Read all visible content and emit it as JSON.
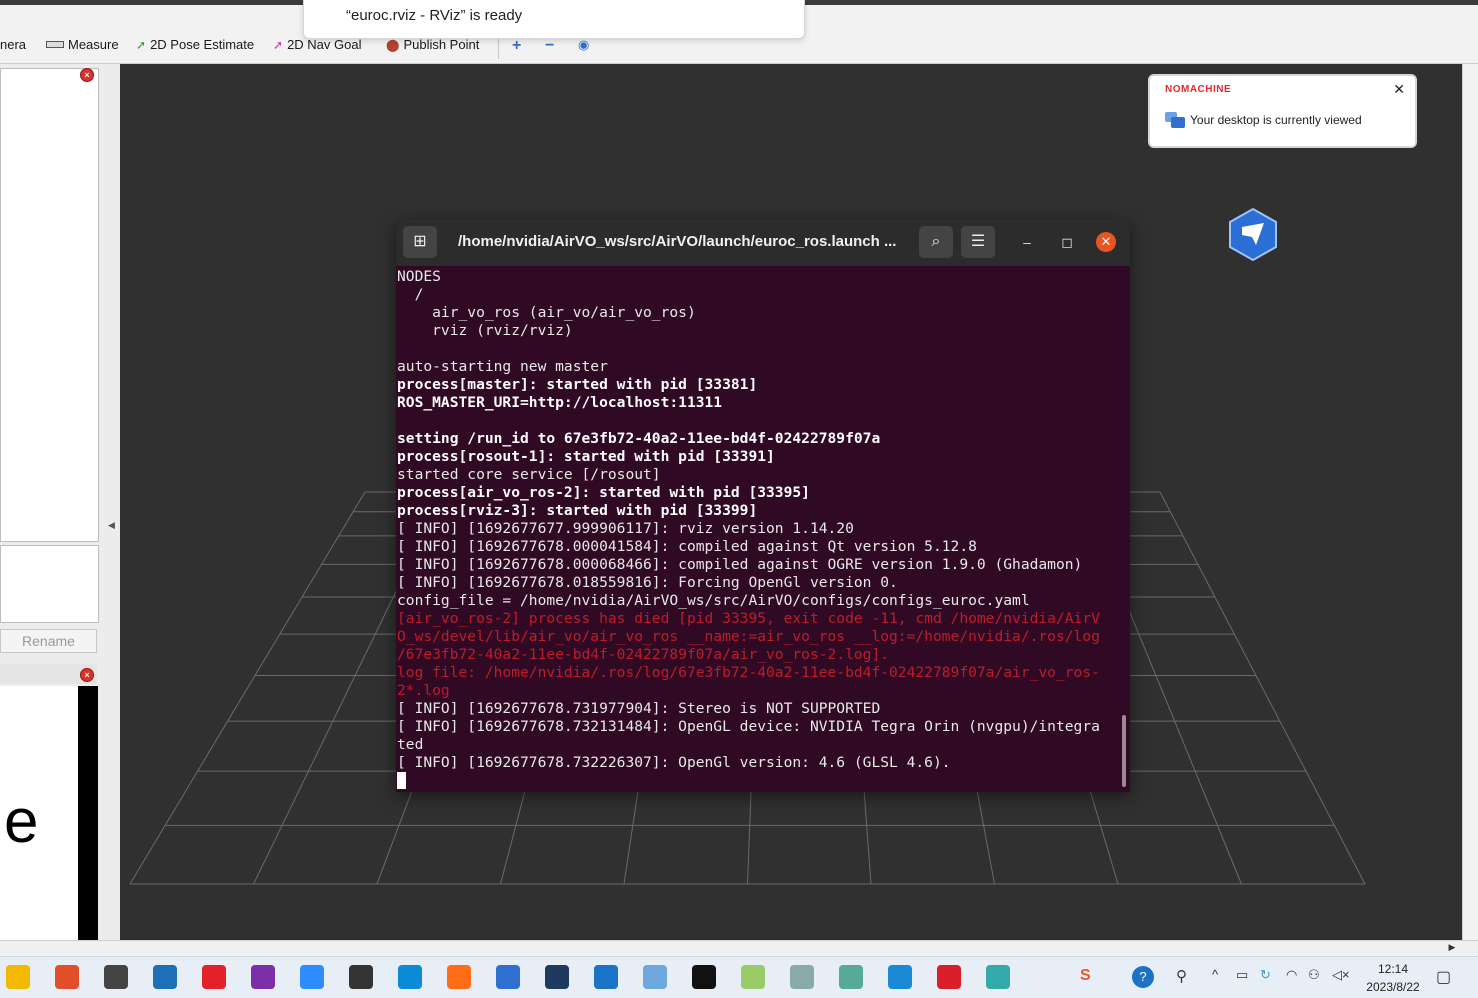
{
  "notification": {
    "text": "“euroc.rviz - RViz” is ready"
  },
  "toolbar": {
    "camera_partial": "nera",
    "measure": "Measure",
    "pose_estimate": "2D Pose Estimate",
    "nav_goal": "2D Nav Goal",
    "publish_point": "Publish Point"
  },
  "left_panel": {
    "rename_label": "Rename",
    "big_letter": "e"
  },
  "nomachine": {
    "brand": "NOMACHINE",
    "message": "Your desktop is currently viewed"
  },
  "terminal": {
    "title": "/home/nvidia/AirVO_ws/src/AirVO/launch/euroc_ros.launch ...",
    "lines": [
      "NODES",
      "  /",
      "    air_vo_ros (air_vo/air_vo_ros)",
      "    rviz (rviz/rviz)",
      "",
      "auto-starting new master",
      "process[master]: started with pid [33381]",
      "ROS_MASTER_URI=http://localhost:11311",
      "",
      "setting /run_id to 67e3fb72-40a2-11ee-bd4f-02422789f07a",
      "process[rosout-1]: started with pid [33391]",
      "started core service [/rosout]",
      "process[air_vo_ros-2]: started with pid [33395]",
      "process[rviz-3]: started with pid [33399]",
      "[ INFO] [1692677677.999906117]: rviz version 1.14.20",
      "[ INFO] [1692677678.000041584]: compiled against Qt version 5.12.8",
      "[ INFO] [1692677678.000068466]: compiled against OGRE version 1.9.0 (Ghadamon)",
      "[ INFO] [1692677678.018559816]: Forcing OpenGl version 0.",
      "config_file = /home/nvidia/AirVO_ws/src/AirVO/configs/configs_euroc.yaml",
      "[air_vo_ros-2] process has died [pid 33395, exit code -11, cmd /home/nvidia/AirV",
      "O_ws/devel/lib/air_vo/air_vo_ros __name:=air_vo_ros __log:=/home/nvidia/.ros/log",
      "/67e3fb72-40a2-11ee-bd4f-02422789f07a/air_vo_ros-2.log].",
      "log file: /home/nvidia/.ros/log/67e3fb72-40a2-11ee-bd4f-02422789f07a/air_vo_ros-",
      "2*.log",
      "[ INFO] [1692677678.731977904]: Stereo is NOT SUPPORTED",
      "[ INFO] [1692677678.732131484]: OpenGL device: NVIDIA Tegra Orin (nvgpu)/integra",
      "ted",
      "[ INFO] [1692677678.732226307]: OpenGl version: 4.6 (GLSL 4.6)."
    ],
    "bold_lines": [
      0,
      0,
      0,
      0,
      0,
      0,
      1,
      1,
      0,
      1,
      1,
      0,
      1,
      1,
      0,
      0,
      0,
      0,
      0,
      0,
      0,
      0,
      0,
      0,
      0,
      0,
      0,
      0
    ],
    "red_lines": [
      0,
      0,
      0,
      0,
      0,
      0,
      0,
      0,
      0,
      0,
      0,
      0,
      0,
      0,
      0,
      0,
      0,
      0,
      0,
      1,
      1,
      1,
      1,
      1,
      0,
      0,
      0,
      0
    ]
  },
  "taskbar": {
    "time": "12:14",
    "date": "2023/8/22",
    "apps": [
      "file-explorer",
      "app-red",
      "mail",
      "store",
      "youdao",
      "onenote",
      "zoom",
      "camera",
      "edge",
      "firefox",
      "feishu",
      "powershell",
      "phone-link",
      "network-app",
      "terminal",
      "color-app",
      "image-viewer",
      "network-tool",
      "send-app",
      "imtoken",
      "rviz-app"
    ],
    "colors": {
      "accent": "#0078d4",
      "terminal_bg": "#300a24",
      "viewport_bg": "#303030",
      "error_red": "#c01c28"
    }
  }
}
